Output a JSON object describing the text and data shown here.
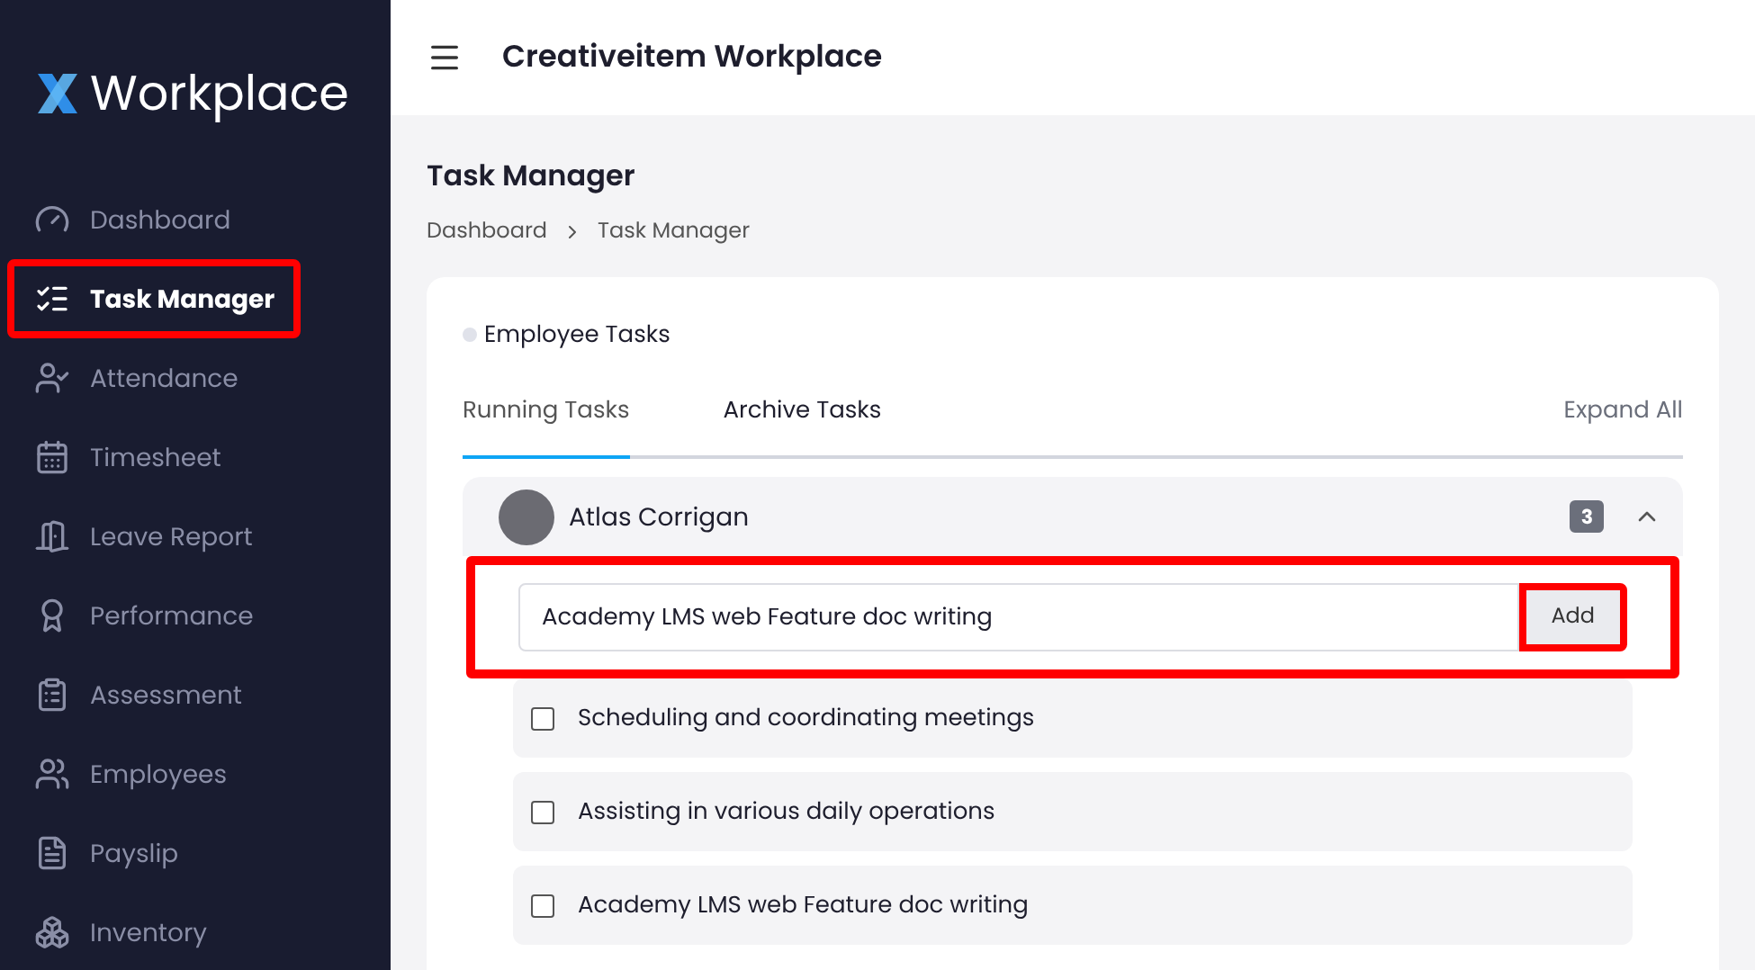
{
  "sidebar": {
    "logo": "Workplace",
    "items": [
      {
        "label": "Dashboard",
        "selected": false,
        "highlighted": false
      },
      {
        "label": "Task Manager",
        "selected": true,
        "highlighted": true
      },
      {
        "label": "Attendance",
        "selected": false,
        "highlighted": false
      },
      {
        "label": "Timesheet",
        "selected": false,
        "highlighted": false
      },
      {
        "label": "Leave Report",
        "selected": false,
        "highlighted": false
      },
      {
        "label": "Performance",
        "selected": false,
        "highlighted": false
      },
      {
        "label": "Assessment",
        "selected": false,
        "highlighted": false
      },
      {
        "label": "Employees",
        "selected": false,
        "highlighted": false
      },
      {
        "label": "Payslip",
        "selected": false,
        "highlighted": false
      },
      {
        "label": "Inventory",
        "selected": false,
        "highlighted": false
      }
    ]
  },
  "header": {
    "title": "Creativeitem Workplace"
  },
  "page": {
    "title": "Task Manager",
    "breadcrumb": [
      "Dashboard",
      "Task Manager"
    ]
  },
  "card": {
    "title": "Employee Tasks",
    "tabs": [
      {
        "label": "Running Tasks",
        "selected": true
      },
      {
        "label": "Archive Tasks",
        "selected": false
      }
    ],
    "expand_all": "Expand All",
    "employee": {
      "name": "Atlas Corrigan",
      "count": "3",
      "expanded": true,
      "new_task": {
        "value": "Academy LMS web Feature doc writing",
        "button": "Add",
        "highlighted": true
      },
      "tasks": [
        {
          "label": "Scheduling and coordinating meetings",
          "checked": false
        },
        {
          "label": "Assisting in various daily operations",
          "checked": false
        },
        {
          "label": "Academy LMS web Feature doc writing",
          "checked": false
        }
      ]
    }
  }
}
